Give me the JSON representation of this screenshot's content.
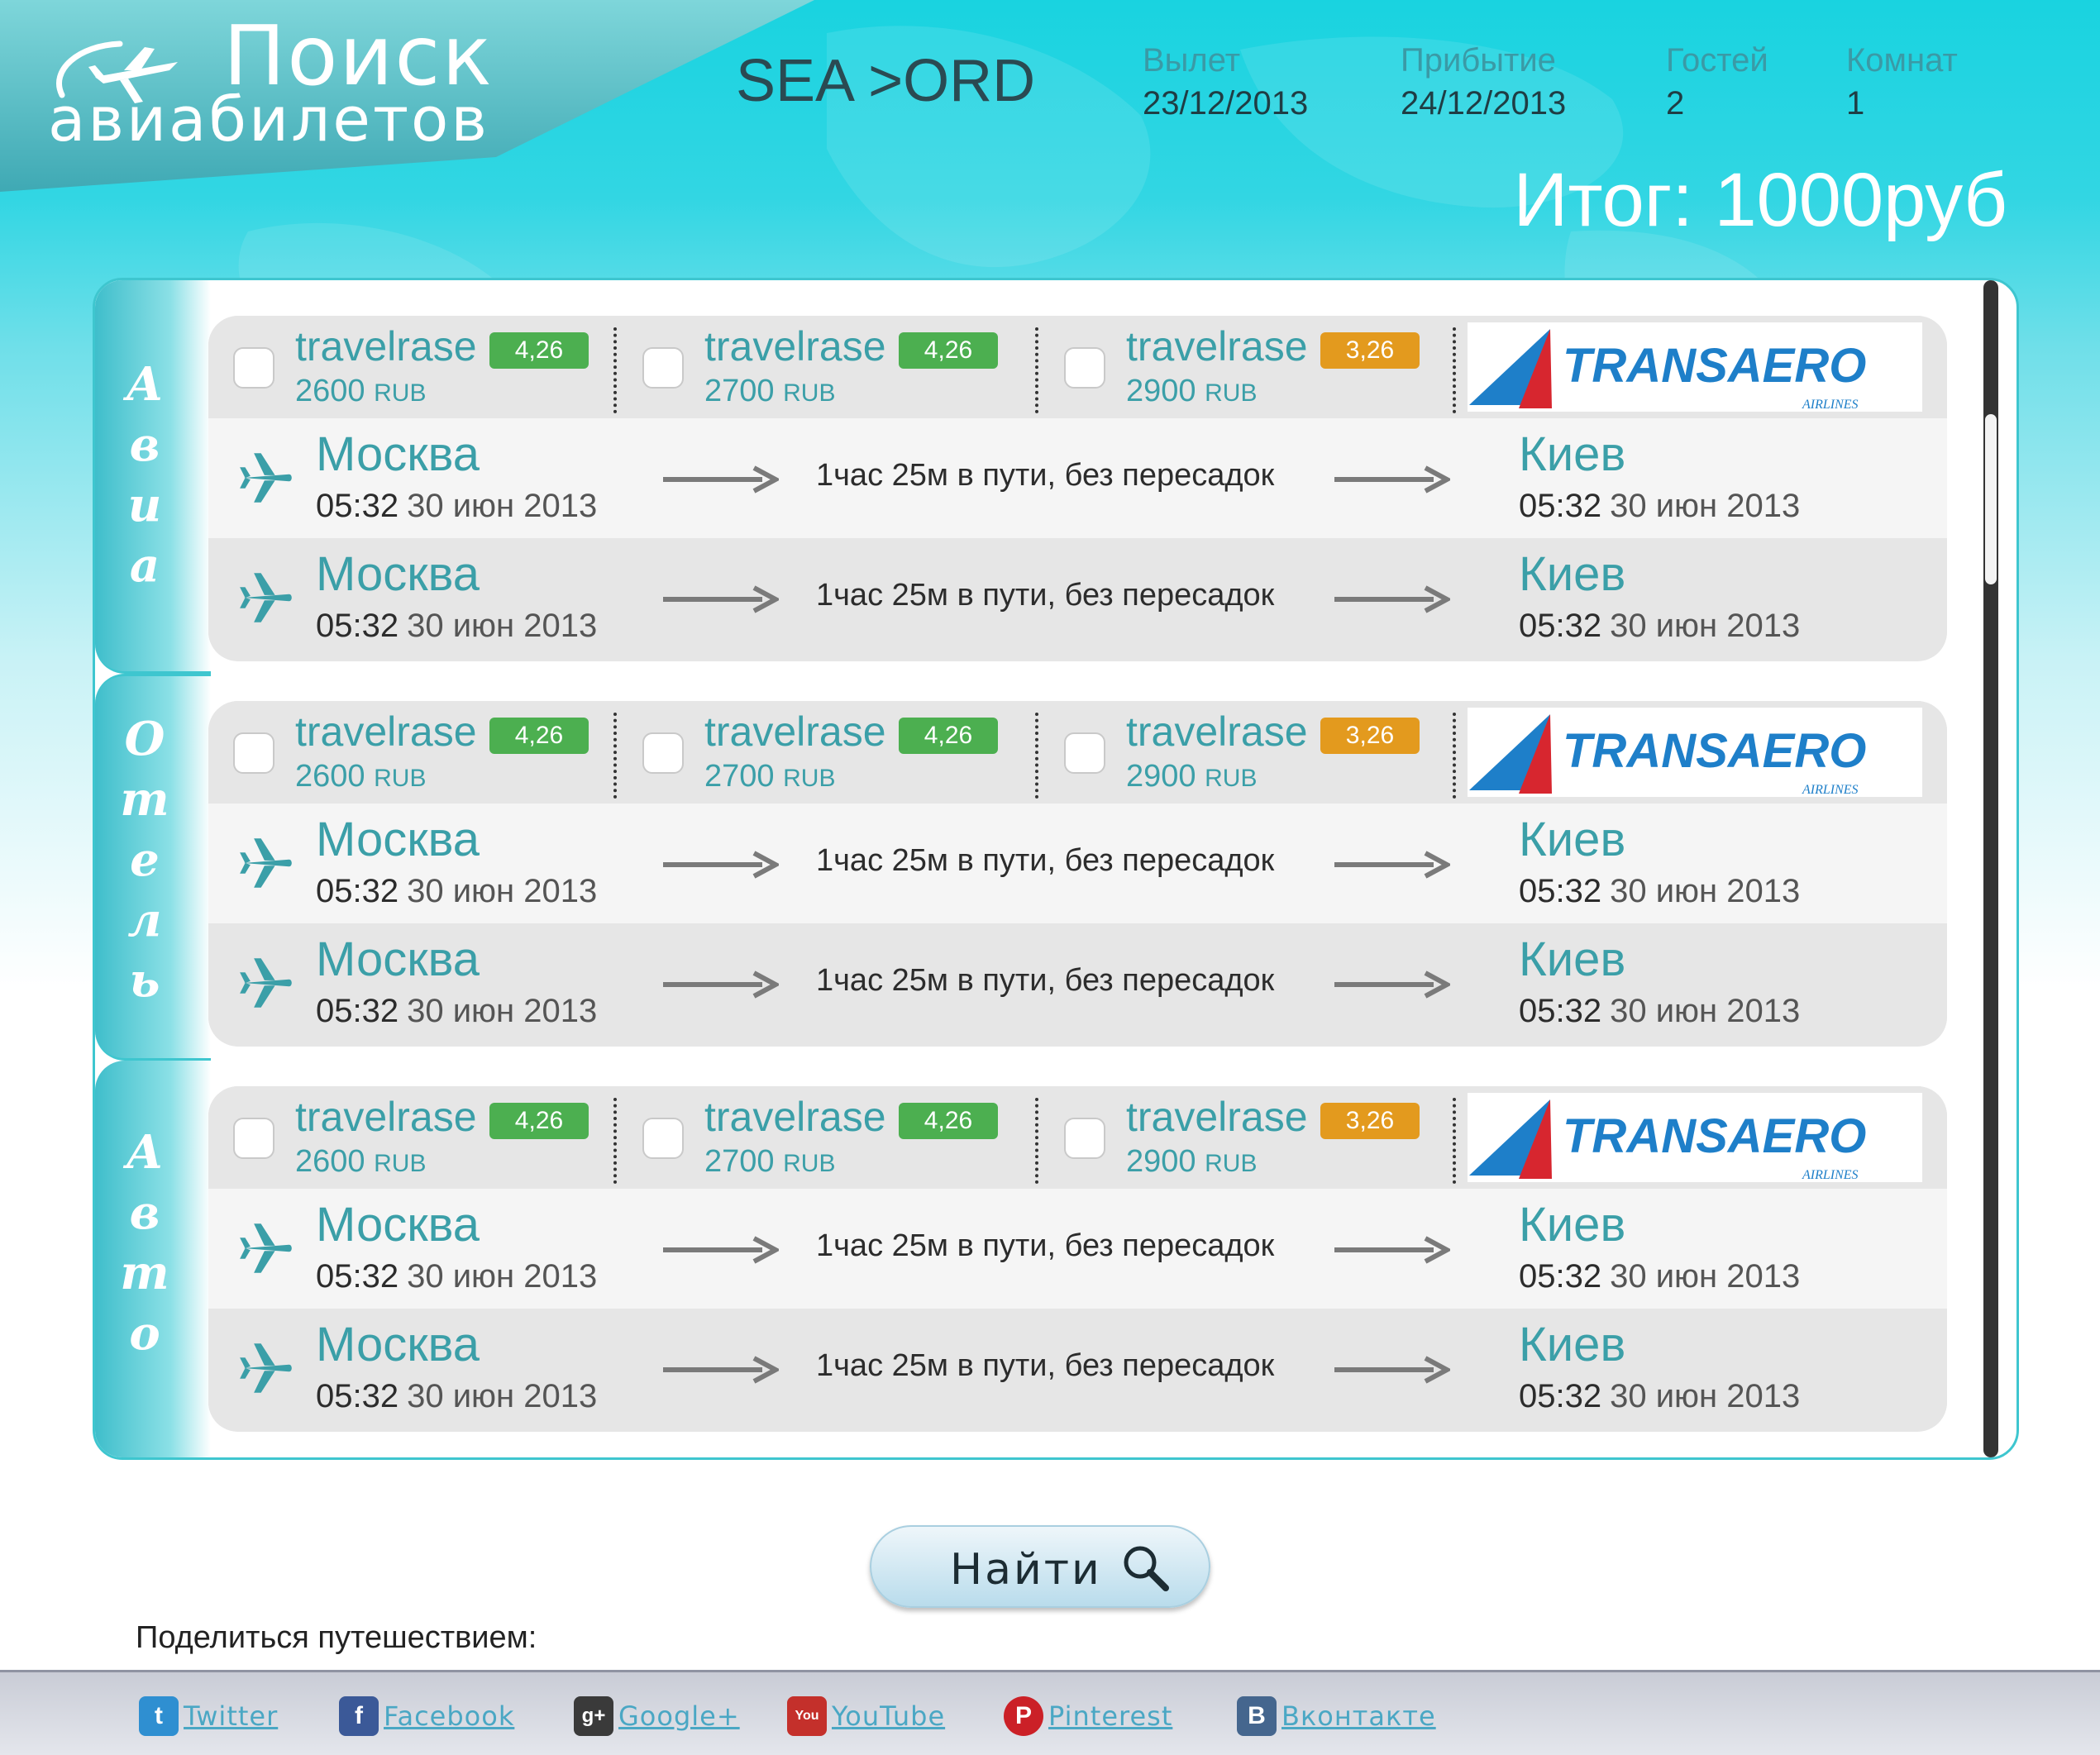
{
  "header": {
    "logo_line1": "Поиск",
    "logo_line2": "авиабилетов",
    "route": "SEA >ORD",
    "departure": {
      "label": "Вылет",
      "value": "23/12/2013"
    },
    "arrival": {
      "label": "Прибытие",
      "value": "24/12/2013"
    },
    "guests": {
      "label": "Гостей",
      "value": "2"
    },
    "rooms": {
      "label": "Комнат",
      "value": "1"
    },
    "total": "Итог: 1000руб"
  },
  "sections": [
    {
      "tab_letters": [
        "А",
        "в",
        "и",
        "а"
      ],
      "offers": [
        {
          "name": "travelrase",
          "rating": "4,26",
          "rating_color": "#4caf50",
          "price": "2600",
          "currency": "RUB"
        },
        {
          "name": "travelrase",
          "rating": "4,26",
          "rating_color": "#4caf50",
          "price": "2700",
          "currency": "RUB"
        },
        {
          "name": "travelrase",
          "rating": "3,26",
          "rating_color": "#e39a1e",
          "price": "2900",
          "currency": "RUB"
        }
      ],
      "airline": {
        "name": "TRANSAERO",
        "sub": "AIRLINES"
      },
      "flights": [
        {
          "from_city": "Москва",
          "from_time": "05:32",
          "from_date": "30 июн 2013",
          "duration": "1час 25м в пути, без пересадок",
          "to_city": "Киев",
          "to_time": "05:32",
          "to_date": "30 июн 2013"
        },
        {
          "from_city": "Москва",
          "from_time": "05:32",
          "from_date": "30 июн 2013",
          "duration": "1час 25м в пути, без пересадок",
          "to_city": "Киев",
          "to_time": "05:32",
          "to_date": "30 июн 2013"
        }
      ]
    },
    {
      "tab_letters": [
        "О",
        "т",
        "е",
        "л",
        "ь"
      ],
      "offers": [
        {
          "name": "travelrase",
          "rating": "4,26",
          "rating_color": "#4caf50",
          "price": "2600",
          "currency": "RUB"
        },
        {
          "name": "travelrase",
          "rating": "4,26",
          "rating_color": "#4caf50",
          "price": "2700",
          "currency": "RUB"
        },
        {
          "name": "travelrase",
          "rating": "3,26",
          "rating_color": "#e39a1e",
          "price": "2900",
          "currency": "RUB"
        }
      ],
      "airline": {
        "name": "TRANSAERO",
        "sub": "AIRLINES"
      },
      "flights": [
        {
          "from_city": "Москва",
          "from_time": "05:32",
          "from_date": "30 июн 2013",
          "duration": "1час 25м в пути, без пересадок",
          "to_city": "Киев",
          "to_time": "05:32",
          "to_date": "30 июн 2013"
        },
        {
          "from_city": "Москва",
          "from_time": "05:32",
          "from_date": "30 июн 2013",
          "duration": "1час 25м в пути, без пересадок",
          "to_city": "Киев",
          "to_time": "05:32",
          "to_date": "30 июн 2013"
        }
      ]
    },
    {
      "tab_letters": [
        "А",
        "в",
        "т",
        "о"
      ],
      "offers": [
        {
          "name": "travelrase",
          "rating": "4,26",
          "rating_color": "#4caf50",
          "price": "2600",
          "currency": "RUB"
        },
        {
          "name": "travelrase",
          "rating": "4,26",
          "rating_color": "#4caf50",
          "price": "2700",
          "currency": "RUB"
        },
        {
          "name": "travelrase",
          "rating": "3,26",
          "rating_color": "#e39a1e",
          "price": "2900",
          "currency": "RUB"
        }
      ],
      "airline": {
        "name": "TRANSAERO",
        "sub": "AIRLINES"
      },
      "flights": [
        {
          "from_city": "Москва",
          "from_time": "05:32",
          "from_date": "30 июн 2013",
          "duration": "1час 25м в пути, без пересадок",
          "to_city": "Киев",
          "to_time": "05:32",
          "to_date": "30 июн 2013"
        },
        {
          "from_city": "Москва",
          "from_time": "05:32",
          "from_date": "30 июн 2013",
          "duration": "1час 25м в пути, без пересадок",
          "to_city": "Киев",
          "to_time": "05:32",
          "to_date": "30 июн 2013"
        }
      ]
    }
  ],
  "search_button": {
    "label": "Найти",
    "icon": "search-icon"
  },
  "share": {
    "title": "Поделиться путешествием:",
    "links": [
      {
        "label": "Twitter",
        "icon": "twitter-icon",
        "glyph": "t",
        "color": "#2f8fd1"
      },
      {
        "label": "Facebook",
        "icon": "facebook-icon",
        "glyph": "f",
        "color": "#3b5998"
      },
      {
        "label": "Google+",
        "icon": "google-plus-icon",
        "glyph": "g+",
        "color": "#3a3a3a"
      },
      {
        "label": "YouTube",
        "icon": "youtube-icon",
        "glyph": "You",
        "color": "#c4302b"
      },
      {
        "label": "Pinterest",
        "icon": "pinterest-icon",
        "glyph": "P",
        "color": "#cb2027"
      },
      {
        "label": "Вконтакте",
        "icon": "vkontakte-icon",
        "glyph": "B",
        "color": "#45668e"
      }
    ]
  }
}
